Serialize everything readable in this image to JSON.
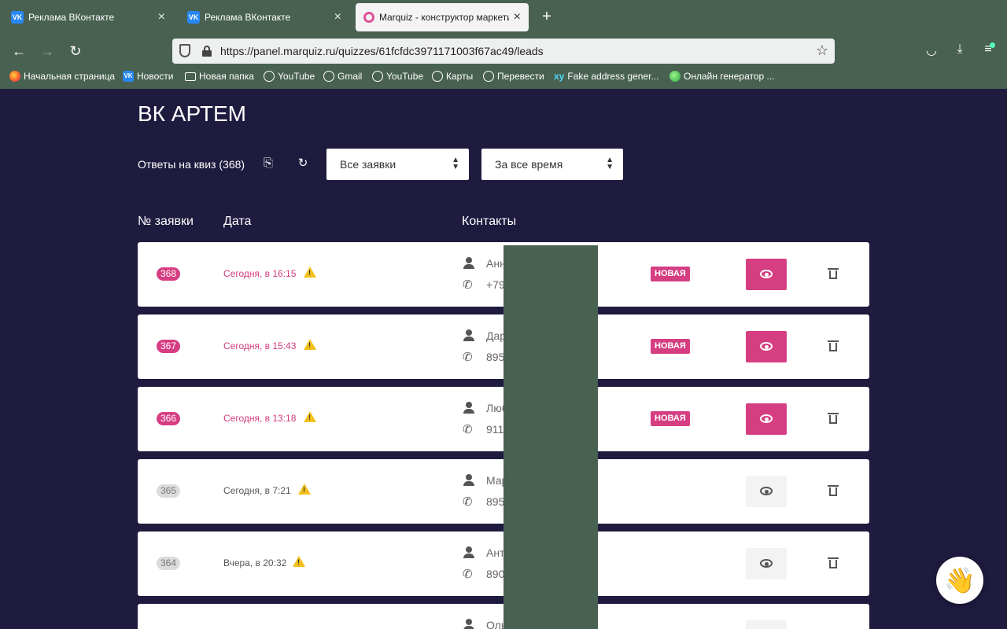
{
  "browser": {
    "tabs": [
      {
        "title": "Реклама ВКонтакте",
        "favicon": "vk-icon"
      },
      {
        "title": "Реклама ВКонтакте",
        "favicon": "vk-icon"
      },
      {
        "title": "Marquiz - конструктор маркети",
        "favicon": "marquiz-icon"
      }
    ],
    "url": "https://panel.marquiz.ru/quizzes/61fcfdc3971171003f67ac49/leads",
    "bookmarks": [
      "Начальная страница",
      "Новости",
      "Новая папка",
      "YouTube",
      "Gmail",
      "YouTube",
      "Карты",
      "Перевести",
      "Fake address gener...",
      "Онлайн генератор ..."
    ],
    "bookmark_xy_label": "xy"
  },
  "page": {
    "title": "ВК АРТЕМ",
    "answers_label": "Ответы на квиз (368)",
    "filter_status": "Все заявки",
    "filter_period": "За все время",
    "col_number": "№ заявки",
    "col_date": "Дата",
    "col_contacts": "Контакты",
    "new_badge": "НОВАЯ"
  },
  "leads": [
    {
      "number": "368",
      "date": "Сегодня, в 16:15",
      "name": "Анн",
      "phone": "+79",
      "is_new": true
    },
    {
      "number": "367",
      "date": "Сегодня, в 15:43",
      "name": "Дар",
      "phone": "895",
      "is_new": true
    },
    {
      "number": "366",
      "date": "Сегодня, в 13:18",
      "name": "Люб",
      "phone": "911",
      "is_new": true
    },
    {
      "number": "365",
      "date": "Сегодня, в 7:21",
      "name": "Мар",
      "phone": "895",
      "is_new": false
    },
    {
      "number": "364",
      "date": "Вчера, в 20:32",
      "name": "Ант",
      "phone": "890",
      "is_new": false
    },
    {
      "number": "",
      "date": "",
      "name": "Оль",
      "phone": "",
      "is_new": false
    }
  ],
  "colors": {
    "accent": "#d63e82",
    "page_bg": "#1e1b3f",
    "chrome_bg": "#486151",
    "warning": "#f2c01a"
  }
}
